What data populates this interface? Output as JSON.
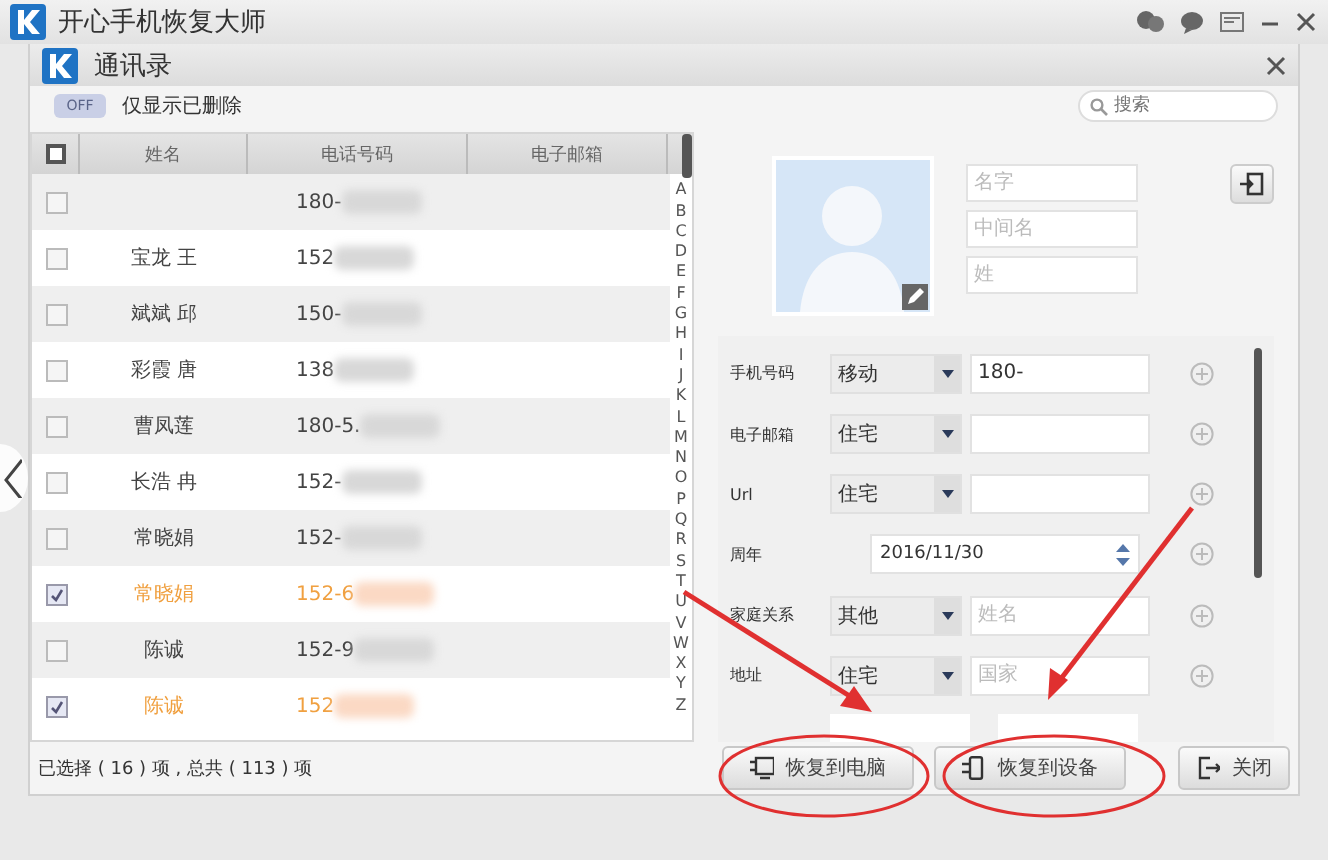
{
  "app": {
    "title": "开心手机恢复大师"
  },
  "dialog": {
    "title": "通讯录"
  },
  "filter": {
    "toggle_text": "OFF",
    "on": false,
    "label": "仅显示已删除"
  },
  "search": {
    "placeholder": "搜索"
  },
  "table": {
    "select_all_checked": false,
    "columns": [
      "姓名",
      "电话号码",
      "电子邮箱"
    ],
    "rows": [
      {
        "name": "",
        "phone": "180-",
        "checked": false
      },
      {
        "name": "宝龙 王",
        "phone": "152",
        "checked": false
      },
      {
        "name": "斌斌 邱",
        "phone": "150-",
        "checked": false
      },
      {
        "name": "彩霞 唐",
        "phone": "138",
        "checked": false
      },
      {
        "name": "曹凤莲",
        "phone": "180-5.",
        "checked": false
      },
      {
        "name": "长浩 冉",
        "phone": "152-",
        "checked": false
      },
      {
        "name": "常晓娟",
        "phone": "152-",
        "checked": false
      },
      {
        "name": "常晓娟",
        "phone": "152-6",
        "checked": true
      },
      {
        "name": "陈诚",
        "phone": "152-9",
        "checked": false
      },
      {
        "name": "陈诚",
        "phone": "152",
        "checked": true
      }
    ]
  },
  "alphabet": [
    "A",
    "B",
    "C",
    "D",
    "E",
    "F",
    "G",
    "H",
    "I",
    "J",
    "K",
    "L",
    "M",
    "N",
    "O",
    "P",
    "Q",
    "R",
    "S",
    "T",
    "U",
    "V",
    "W",
    "X",
    "Y",
    "Z"
  ],
  "status": "已选择 ( 16 ) 项 , 总共 ( 113 ) 项",
  "detail": {
    "name_fields": [
      {
        "placeholder": "名字"
      },
      {
        "placeholder": "中间名"
      },
      {
        "placeholder": "姓"
      }
    ],
    "fields": [
      {
        "kind": "select",
        "label": "手机号码",
        "type": "移动",
        "value": "180-"
      },
      {
        "kind": "select",
        "label": "电子邮箱",
        "type": "住宅"
      },
      {
        "kind": "select",
        "label": "Url",
        "type": "住宅"
      },
      {
        "kind": "date",
        "label": "周年",
        "value": "2016/11/30"
      },
      {
        "kind": "select",
        "label": "家庭关系",
        "type": "其他",
        "placeholder": "姓名"
      },
      {
        "kind": "select",
        "label": "地址",
        "type": "住宅",
        "placeholder": "国家"
      }
    ]
  },
  "buttons": [
    {
      "label": "恢复到电脑",
      "kind": "computer"
    },
    {
      "label": "恢复到设备",
      "kind": "device"
    },
    {
      "label": "关闭",
      "kind": "close"
    }
  ]
}
